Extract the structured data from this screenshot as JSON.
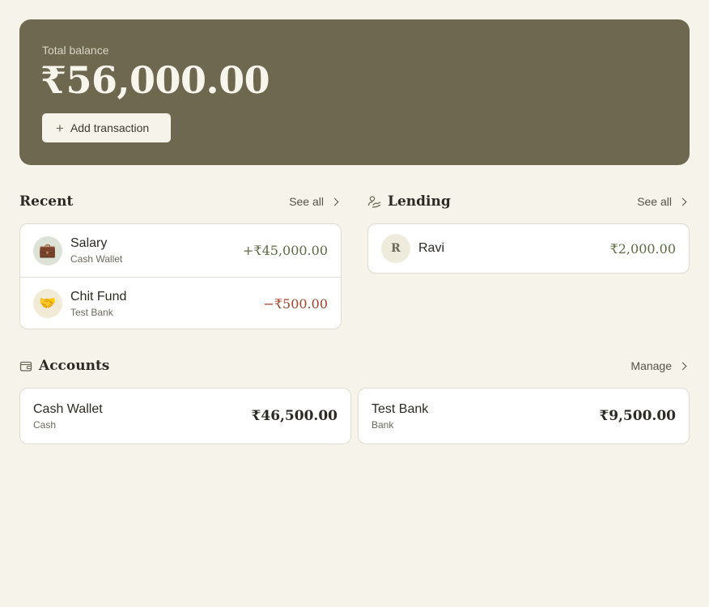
{
  "hero": {
    "label": "Total balance",
    "amount": "₹56,000.00",
    "add_button_label": "Add transaction"
  },
  "recent": {
    "title": "Recent",
    "see_all": "See all",
    "items": [
      {
        "title": "Salary",
        "account": "Cash Wallet",
        "amount": "+₹45,000.00",
        "icon": "briefcase-icon",
        "amount_color": "#5e6b45"
      },
      {
        "title": "Chit Fund",
        "account": "Test Bank",
        "amount": "−₹500.00",
        "icon": "handshake-icon",
        "amount_color": "#a0442c"
      }
    ]
  },
  "lending": {
    "title": "Lending",
    "see_all": "See all",
    "items": [
      {
        "initial": "R",
        "name": "Ravi",
        "amount": "₹2,000.00",
        "amount_color": "#5e6b45"
      }
    ]
  },
  "accounts": {
    "title": "Accounts",
    "manage": "Manage",
    "items": [
      {
        "name": "Cash Wallet",
        "type": "Cash",
        "balance": "₹46,500.00"
      },
      {
        "name": "Test Bank",
        "type": "Bank",
        "balance": "₹9,500.00"
      }
    ]
  },
  "colors": {
    "background": "#f6f3ea",
    "hero": "#6e6850",
    "positive": "#5e6b45",
    "negative": "#a0442c"
  }
}
